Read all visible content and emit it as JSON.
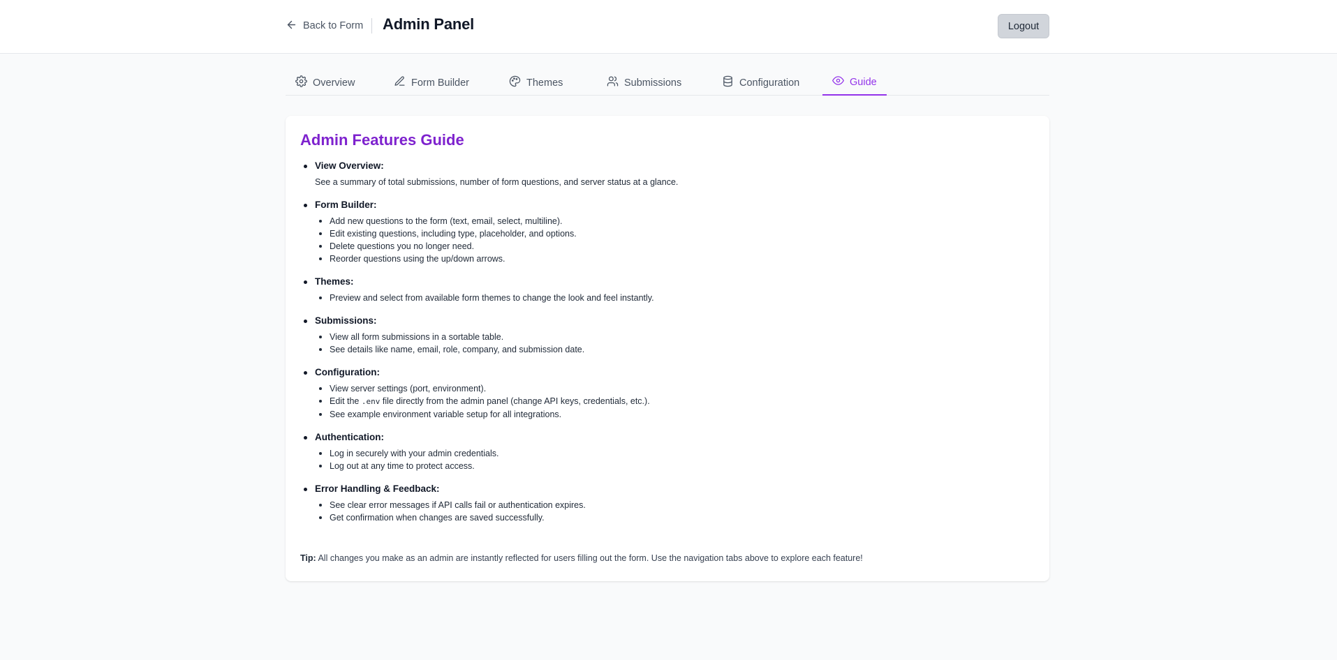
{
  "header": {
    "back_label": "Back to Form",
    "title": "Admin Panel",
    "logout_label": "Logout"
  },
  "tabs": [
    {
      "label": "Overview",
      "icon": "gear-icon",
      "active": false
    },
    {
      "label": "Form Builder",
      "icon": "pencil-icon",
      "active": false
    },
    {
      "label": "Themes",
      "icon": "palette-icon",
      "active": false
    },
    {
      "label": "Submissions",
      "icon": "users-icon",
      "active": false
    },
    {
      "label": "Configuration",
      "icon": "database-icon",
      "active": false
    },
    {
      "label": "Guide",
      "icon": "eye-icon",
      "active": true
    }
  ],
  "colors": {
    "accent": "#9333ea",
    "title_purple": "#7e22ce",
    "background": "#f9fafb",
    "logout_bg": "#d1d5db"
  },
  "guide": {
    "title": "Admin Features Guide",
    "sections": [
      {
        "title": "View Overview:",
        "description": "See a summary of total submissions, number of form questions, and server status at a glance."
      },
      {
        "title": "Form Builder:",
        "items": [
          "Add new questions to the form (text, email, select, multiline).",
          "Edit existing questions, including type, placeholder, and options.",
          "Delete questions you no longer need.",
          "Reorder questions using the up/down arrows."
        ]
      },
      {
        "title": "Themes:",
        "items": [
          "Preview and select from available form themes to change the look and feel instantly."
        ]
      },
      {
        "title": "Submissions:",
        "items": [
          "View all form submissions in a sortable table.",
          "See details like name, email, role, company, and submission date."
        ]
      },
      {
        "title": "Configuration:",
        "items": [
          "View server settings (port, environment).",
          {
            "before": "Edit the ",
            "code": ".env",
            "after": " file directly from the admin panel (change API keys, credentials, etc.)."
          },
          "See example environment variable setup for all integrations."
        ]
      },
      {
        "title": "Authentication:",
        "items": [
          "Log in securely with your admin credentials.",
          "Log out at any time to protect access."
        ]
      },
      {
        "title": "Error Handling & Feedback:",
        "items": [
          "See clear error messages if API calls fail or authentication expires.",
          "Get confirmation when changes are saved successfully."
        ]
      }
    ],
    "tip": {
      "label": "Tip:",
      "text": " All changes you make as an admin are instantly reflected for users filling out the form. Use the navigation tabs above to explore each feature!"
    }
  }
}
